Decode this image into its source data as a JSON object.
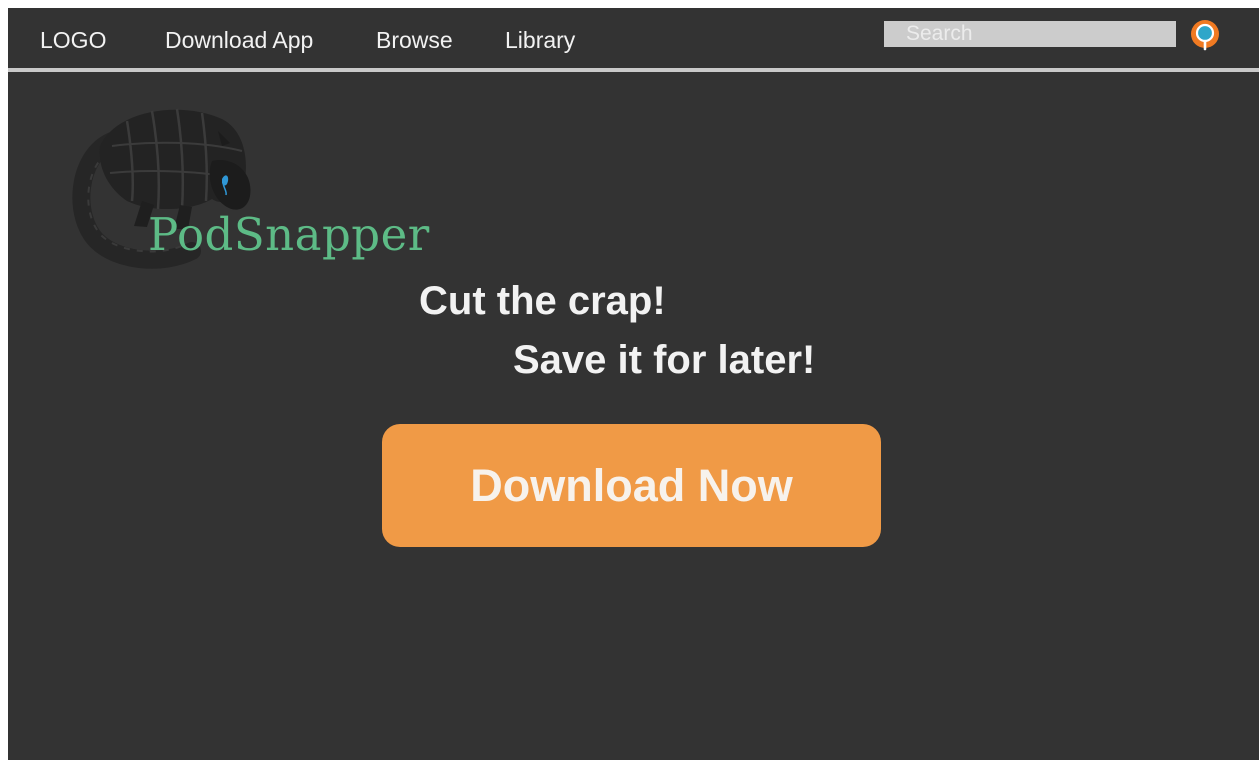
{
  "nav": {
    "logo": "LOGO",
    "download_app": "Download App",
    "browse": "Browse",
    "library": "Library"
  },
  "search": {
    "placeholder": "Search"
  },
  "hero": {
    "brand": "PodSnapper",
    "tagline_line1": "Cut the crap!",
    "tagline_line2": "Save it for later!",
    "cta_label": "Download Now"
  },
  "icons": {
    "search": "search-icon",
    "mascot": "armadillo-mascot-icon"
  },
  "colors": {
    "background": "#333333",
    "nav_divider": "#c9c9c9",
    "text": "#f2f2f2",
    "brand": "#5dbb86",
    "accent": "#f09a46",
    "search_field": "#cccccc"
  }
}
